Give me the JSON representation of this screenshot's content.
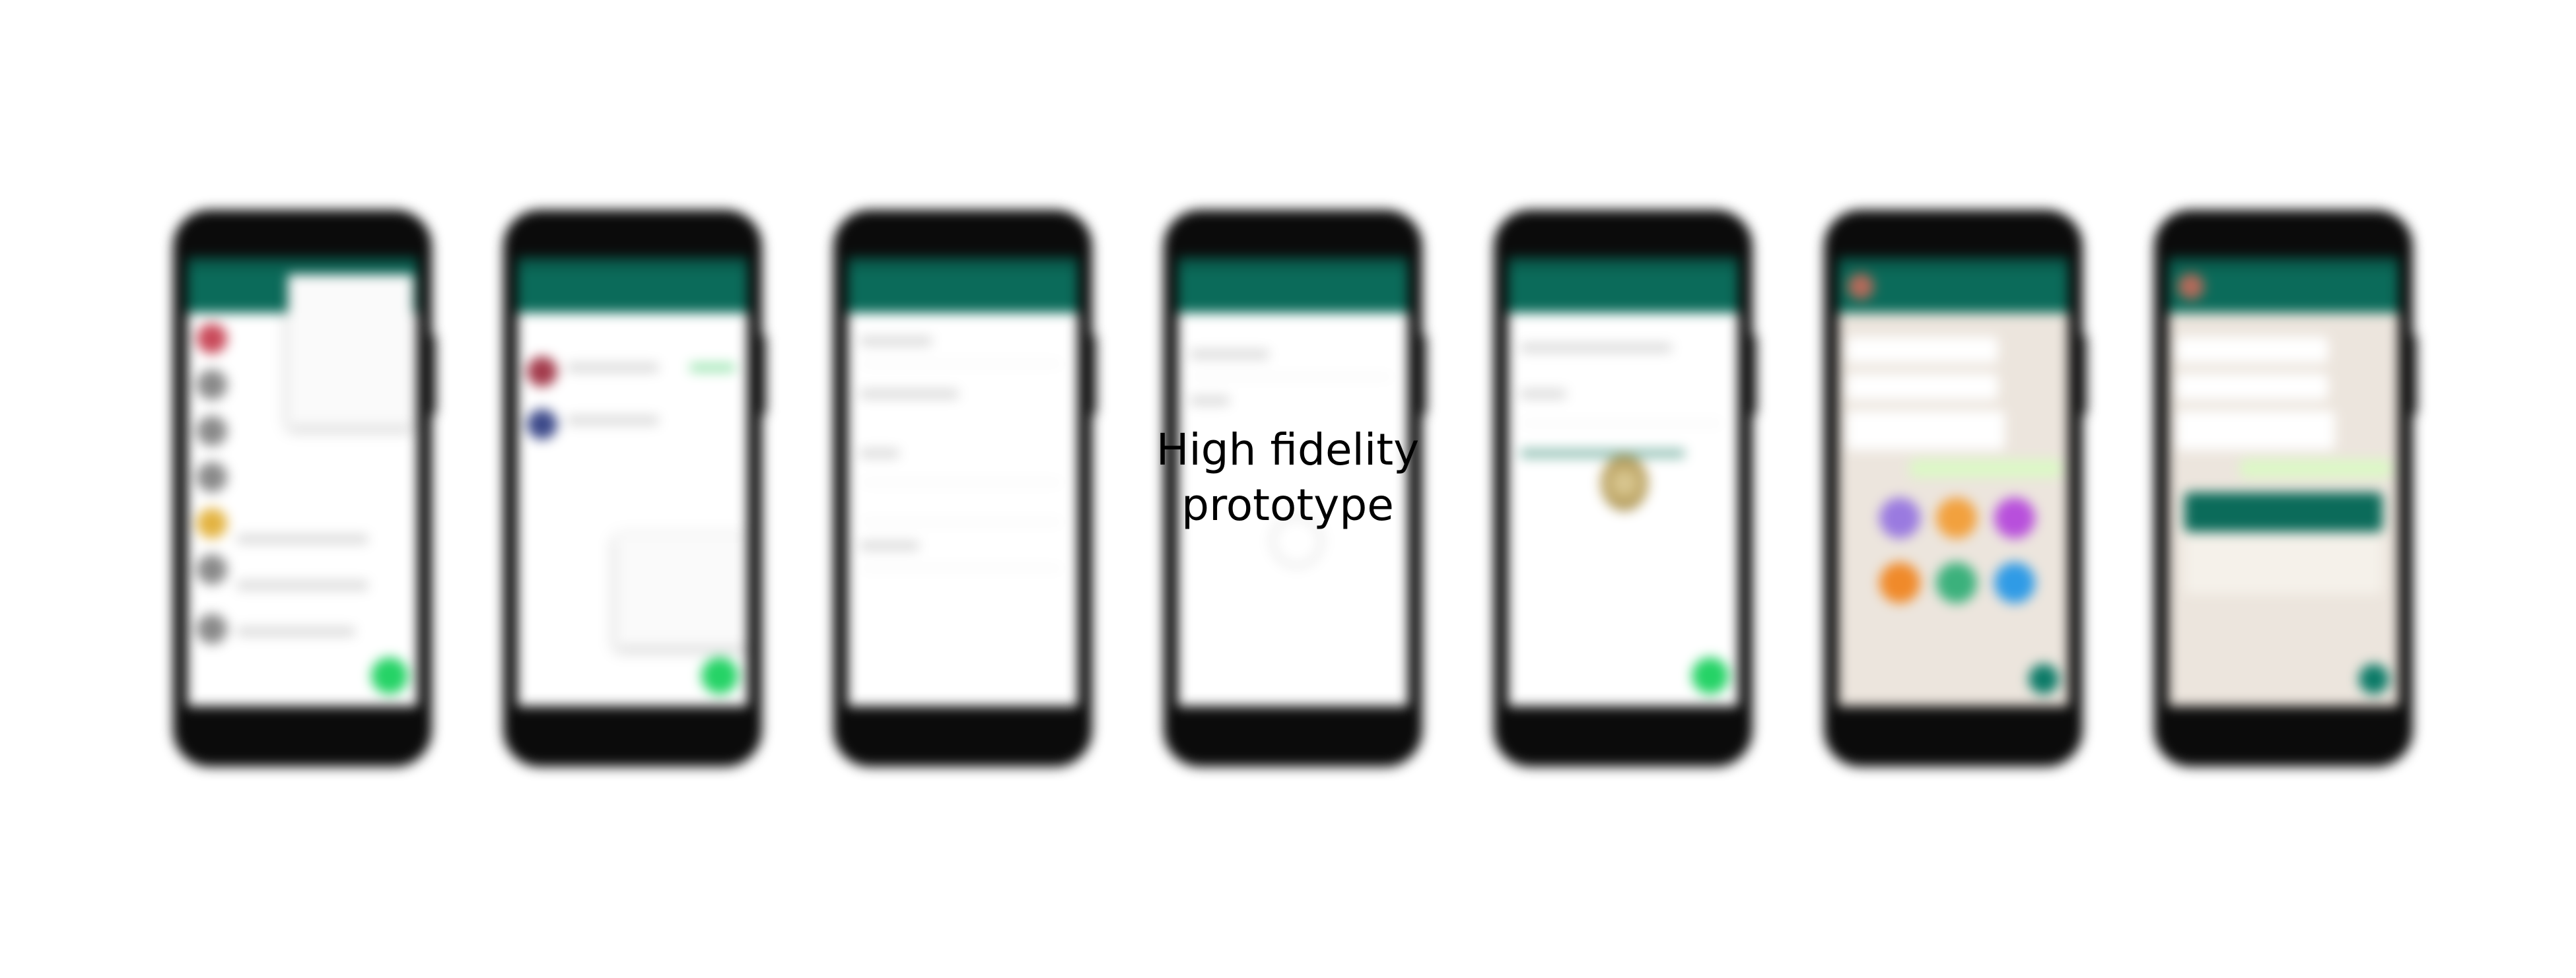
{
  "caption": {
    "line1": "High fidelity",
    "line2": "prototype"
  },
  "colors": {
    "background": "#ffffff",
    "app_bar": "#0b6b5a",
    "fab": "#25d366",
    "chat_background": "#ece5dd",
    "outgoing_bubble": "#dcf8c6",
    "phone_body": "#0b0b0b"
  },
  "mockups": [
    {
      "screen": "chat-list-with-overflow-menu",
      "icons": [
        "menu-icon",
        "new-chat-fab-icon"
      ]
    },
    {
      "screen": "chat-list-with-context-menu",
      "icons": [
        "new-chat-fab-icon"
      ]
    },
    {
      "screen": "settings-form",
      "icons": []
    },
    {
      "screen": "loading-form",
      "icons": [
        "loading-spinner-icon"
      ]
    },
    {
      "screen": "sticker-detail",
      "icons": [
        "sticker-icon",
        "new-chat-fab-icon"
      ]
    },
    {
      "screen": "conversation-attachment-picker",
      "icons": [
        "attachment-icons"
      ]
    },
    {
      "screen": "conversation-message-sheet",
      "icons": [
        "send-icon"
      ]
    }
  ]
}
